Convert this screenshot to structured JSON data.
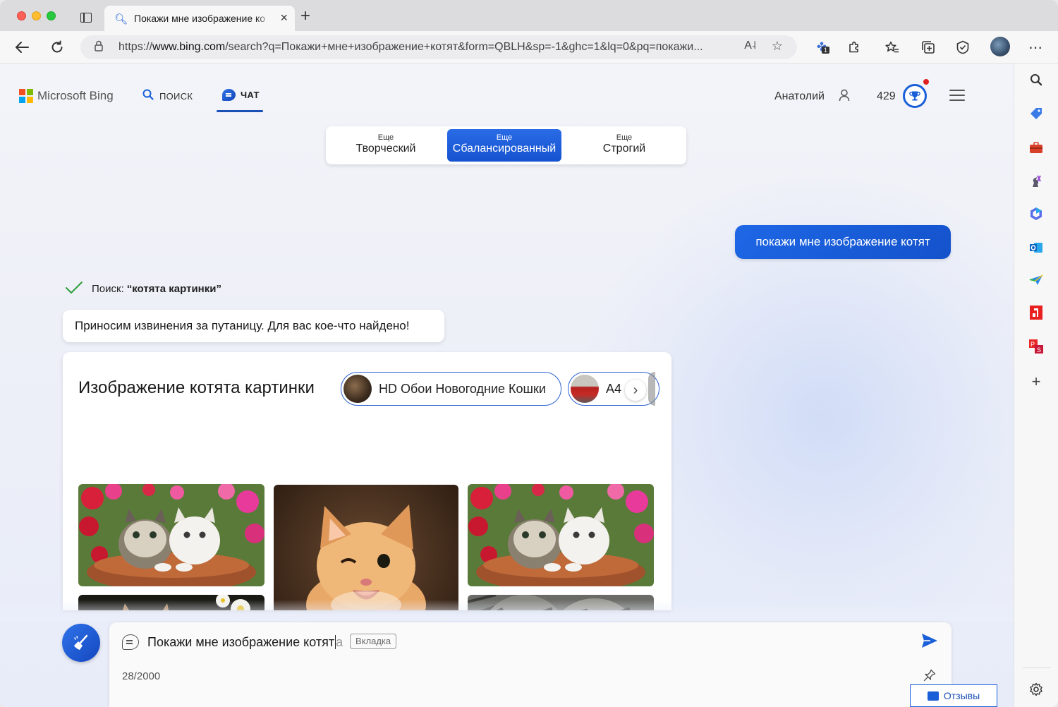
{
  "browser": {
    "tab_title": "Покажи мне изображение ко",
    "url_prefix": "https://",
    "url_host": "www.bing.com",
    "url_rest": "/search?q=Покажи+мне+изображение+котят&form=QBLH&sp=-1&ghc=1&lq=0&pq=покажи...",
    "extension_badge": "1"
  },
  "header": {
    "logo_text": "Microsoft Bing",
    "nav": [
      {
        "label": "ПОИСК",
        "icon": "search-icon"
      },
      {
        "label": "ЧАТ",
        "icon": "chat-icon",
        "active": true
      }
    ],
    "user_name": "Анатолий",
    "points": "429"
  },
  "tones": [
    {
      "small": "Еще",
      "label": "Творческий",
      "selected": false
    },
    {
      "small": "Еще",
      "label": "Сбалансированный",
      "selected": true
    },
    {
      "small": "Еще",
      "label": "Строгий",
      "selected": false
    }
  ],
  "conversation": {
    "user_message": "покажи мне изображение котят",
    "search_prefix": "Поиск:",
    "search_query": "“котята картинки”",
    "bot_message": "Приносим извинения за путаницу. Для вас кое-что найдено!",
    "image_card": {
      "title": "Изображение котята картинки",
      "chips": [
        "HD Обои Новогодние Кошки",
        "А4"
      ]
    }
  },
  "composer": {
    "input_value": "Покажи мне изображение котят",
    "ghost_completion": "а",
    "tab_hint": "Вкладка",
    "counter": "28/2000"
  },
  "feedback_label": "Отзывы",
  "colors": {
    "accent": "#1a5fd8",
    "selected_tone": "#1552cf",
    "check": "#2e9e3a"
  }
}
